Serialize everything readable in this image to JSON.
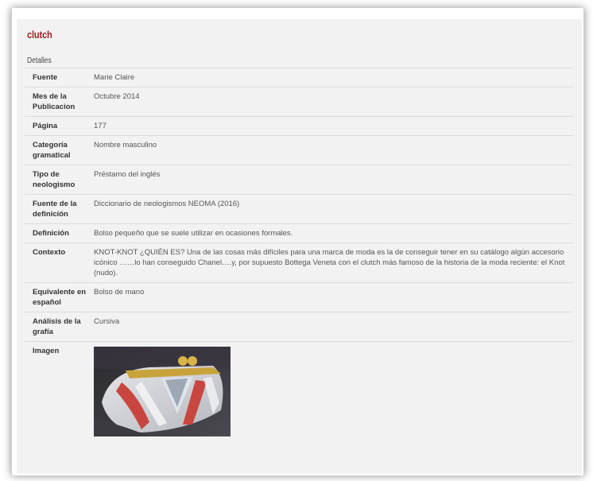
{
  "term": "clutch",
  "section_title": "Detalles",
  "rows": [
    {
      "label": "Fuente",
      "value": "Marie Claire"
    },
    {
      "label": "Mes de la Publicacion",
      "value": "Octubre 2014"
    },
    {
      "label": "Página",
      "value": "177"
    },
    {
      "label": "Categoría gramatical",
      "value": "Nombre masculino"
    },
    {
      "label": "Tipo de neologismo",
      "value": "Préstamo del inglés"
    },
    {
      "label": "Fuente de la definición",
      "value": "Diccionario de neologismos NEOMA (2016)"
    },
    {
      "label": "Definición",
      "value": "Bolso pequeño que se suele utilizar en ocasiones formales."
    },
    {
      "label": "Contexto",
      "value": "KNOT-KNOT ¿QUIÉN ES? Una de las cosas más difíciles para una marca de moda es la de conseguir tener en su catálogo algún accesorio icónico ……lo han conseguido Chanel….y, por supuesto Bottega Veneta con el clutch más famoso de la historia de la moda reciente: el Knot (nudo)."
    },
    {
      "label": "Equivalente en español",
      "value": "Bolso de mano"
    },
    {
      "label": "Análisis de la grafía",
      "value": "Cursiva"
    }
  ],
  "image_row": {
    "label": "Imagen",
    "image_alt": "clutch bag photo"
  },
  "colors": {
    "title": "#a3232a",
    "panel": "#f2f2f2",
    "border": "#dcdcdc"
  }
}
